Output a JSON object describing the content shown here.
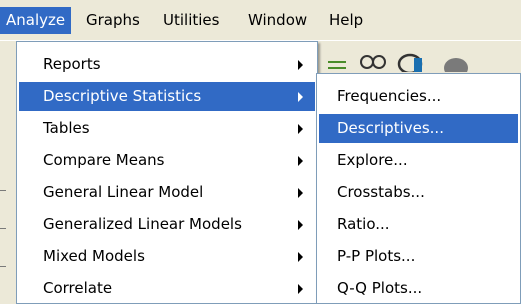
{
  "menubar": {
    "items": [
      {
        "label": "Analyze"
      },
      {
        "label": "Graphs"
      },
      {
        "label": "Utilities"
      },
      {
        "label": "Window"
      },
      {
        "label": "Help"
      }
    ]
  },
  "analyze_menu": {
    "items": [
      {
        "label": "Reports",
        "submenu": true
      },
      {
        "label": "Descriptive Statistics",
        "submenu": true,
        "highlighted": true
      },
      {
        "label": "Tables",
        "submenu": true
      },
      {
        "label": "Compare Means",
        "submenu": true
      },
      {
        "label": "General Linear Model",
        "submenu": true
      },
      {
        "label": "Generalized Linear Models",
        "submenu": true
      },
      {
        "label": "Mixed Models",
        "submenu": true
      },
      {
        "label": "Correlate",
        "submenu": true
      }
    ]
  },
  "descriptive_statistics_submenu": {
    "items": [
      {
        "label": "Frequencies..."
      },
      {
        "label": "Descriptives...",
        "highlighted": true
      },
      {
        "label": "Explore..."
      },
      {
        "label": "Crosstabs..."
      },
      {
        "label": "Ratio..."
      },
      {
        "label": "P-P Plots..."
      },
      {
        "label": "Q-Q Plots..."
      }
    ]
  },
  "colors": {
    "menu_highlight": "#316ac5",
    "menu_background": "#ffffff",
    "chrome_background": "#ece9d8"
  },
  "toolbar": {
    "icons": [
      "toolbar-grid-icon",
      "toolbar-binoculars-icon",
      "toolbar-chart-icon",
      "toolbar-circle-icon"
    ]
  }
}
